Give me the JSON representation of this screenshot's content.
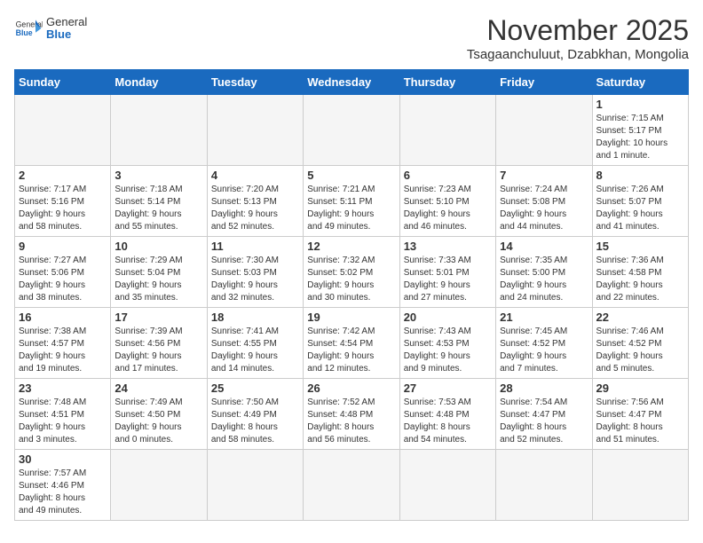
{
  "header": {
    "logo_general": "General",
    "logo_blue": "Blue",
    "month_title": "November 2025",
    "location": "Tsagaanchuluut, Dzabkhan, Mongolia"
  },
  "weekdays": [
    "Sunday",
    "Monday",
    "Tuesday",
    "Wednesday",
    "Thursday",
    "Friday",
    "Saturday"
  ],
  "weeks": [
    [
      {
        "day": null,
        "info": ""
      },
      {
        "day": null,
        "info": ""
      },
      {
        "day": null,
        "info": ""
      },
      {
        "day": null,
        "info": ""
      },
      {
        "day": null,
        "info": ""
      },
      {
        "day": null,
        "info": ""
      },
      {
        "day": "1",
        "info": "Sunrise: 7:15 AM\nSunset: 5:17 PM\nDaylight: 10 hours\nand 1 minute."
      }
    ],
    [
      {
        "day": "2",
        "info": "Sunrise: 7:17 AM\nSunset: 5:16 PM\nDaylight: 9 hours\nand 58 minutes."
      },
      {
        "day": "3",
        "info": "Sunrise: 7:18 AM\nSunset: 5:14 PM\nDaylight: 9 hours\nand 55 minutes."
      },
      {
        "day": "4",
        "info": "Sunrise: 7:20 AM\nSunset: 5:13 PM\nDaylight: 9 hours\nand 52 minutes."
      },
      {
        "day": "5",
        "info": "Sunrise: 7:21 AM\nSunset: 5:11 PM\nDaylight: 9 hours\nand 49 minutes."
      },
      {
        "day": "6",
        "info": "Sunrise: 7:23 AM\nSunset: 5:10 PM\nDaylight: 9 hours\nand 46 minutes."
      },
      {
        "day": "7",
        "info": "Sunrise: 7:24 AM\nSunset: 5:08 PM\nDaylight: 9 hours\nand 44 minutes."
      },
      {
        "day": "8",
        "info": "Sunrise: 7:26 AM\nSunset: 5:07 PM\nDaylight: 9 hours\nand 41 minutes."
      }
    ],
    [
      {
        "day": "9",
        "info": "Sunrise: 7:27 AM\nSunset: 5:06 PM\nDaylight: 9 hours\nand 38 minutes."
      },
      {
        "day": "10",
        "info": "Sunrise: 7:29 AM\nSunset: 5:04 PM\nDaylight: 9 hours\nand 35 minutes."
      },
      {
        "day": "11",
        "info": "Sunrise: 7:30 AM\nSunset: 5:03 PM\nDaylight: 9 hours\nand 32 minutes."
      },
      {
        "day": "12",
        "info": "Sunrise: 7:32 AM\nSunset: 5:02 PM\nDaylight: 9 hours\nand 30 minutes."
      },
      {
        "day": "13",
        "info": "Sunrise: 7:33 AM\nSunset: 5:01 PM\nDaylight: 9 hours\nand 27 minutes."
      },
      {
        "day": "14",
        "info": "Sunrise: 7:35 AM\nSunset: 5:00 PM\nDaylight: 9 hours\nand 24 minutes."
      },
      {
        "day": "15",
        "info": "Sunrise: 7:36 AM\nSunset: 4:58 PM\nDaylight: 9 hours\nand 22 minutes."
      }
    ],
    [
      {
        "day": "16",
        "info": "Sunrise: 7:38 AM\nSunset: 4:57 PM\nDaylight: 9 hours\nand 19 minutes."
      },
      {
        "day": "17",
        "info": "Sunrise: 7:39 AM\nSunset: 4:56 PM\nDaylight: 9 hours\nand 17 minutes."
      },
      {
        "day": "18",
        "info": "Sunrise: 7:41 AM\nSunset: 4:55 PM\nDaylight: 9 hours\nand 14 minutes."
      },
      {
        "day": "19",
        "info": "Sunrise: 7:42 AM\nSunset: 4:54 PM\nDaylight: 9 hours\nand 12 minutes."
      },
      {
        "day": "20",
        "info": "Sunrise: 7:43 AM\nSunset: 4:53 PM\nDaylight: 9 hours\nand 9 minutes."
      },
      {
        "day": "21",
        "info": "Sunrise: 7:45 AM\nSunset: 4:52 PM\nDaylight: 9 hours\nand 7 minutes."
      },
      {
        "day": "22",
        "info": "Sunrise: 7:46 AM\nSunset: 4:52 PM\nDaylight: 9 hours\nand 5 minutes."
      }
    ],
    [
      {
        "day": "23",
        "info": "Sunrise: 7:48 AM\nSunset: 4:51 PM\nDaylight: 9 hours\nand 3 minutes."
      },
      {
        "day": "24",
        "info": "Sunrise: 7:49 AM\nSunset: 4:50 PM\nDaylight: 9 hours\nand 0 minutes."
      },
      {
        "day": "25",
        "info": "Sunrise: 7:50 AM\nSunset: 4:49 PM\nDaylight: 8 hours\nand 58 minutes."
      },
      {
        "day": "26",
        "info": "Sunrise: 7:52 AM\nSunset: 4:48 PM\nDaylight: 8 hours\nand 56 minutes."
      },
      {
        "day": "27",
        "info": "Sunrise: 7:53 AM\nSunset: 4:48 PM\nDaylight: 8 hours\nand 54 minutes."
      },
      {
        "day": "28",
        "info": "Sunrise: 7:54 AM\nSunset: 4:47 PM\nDaylight: 8 hours\nand 52 minutes."
      },
      {
        "day": "29",
        "info": "Sunrise: 7:56 AM\nSunset: 4:47 PM\nDaylight: 8 hours\nand 51 minutes."
      }
    ],
    [
      {
        "day": "30",
        "info": "Sunrise: 7:57 AM\nSunset: 4:46 PM\nDaylight: 8 hours\nand 49 minutes."
      },
      {
        "day": null,
        "info": ""
      },
      {
        "day": null,
        "info": ""
      },
      {
        "day": null,
        "info": ""
      },
      {
        "day": null,
        "info": ""
      },
      {
        "day": null,
        "info": ""
      },
      {
        "day": null,
        "info": ""
      }
    ]
  ]
}
